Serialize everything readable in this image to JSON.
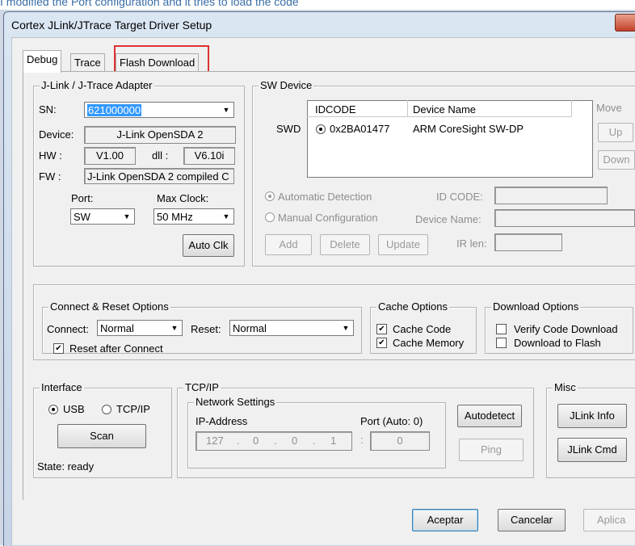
{
  "caption": "I modified the Port configuration and it tries  to load the code",
  "window": {
    "title": "Cortex JLink/JTrace Target Driver Setup"
  },
  "tabs": [
    {
      "label": "Debug"
    },
    {
      "label": "Trace"
    },
    {
      "label": "Flash Download"
    }
  ],
  "adapter": {
    "group_label": "J-Link / J-Trace Adapter",
    "sn_label": "SN:",
    "sn_value": "621000000",
    "device_label": "Device:",
    "device_value": "J-Link OpenSDA 2",
    "hw_label": "HW :",
    "hw_value": "V1.00",
    "dll_label": "dll :",
    "dll_value": "V6.10i",
    "fw_label": "FW :",
    "fw_value": "J-Link OpenSDA 2 compiled C",
    "port_label": "Port:",
    "port_value": "SW",
    "clock_label": "Max Clock:",
    "clock_value": "50 MHz",
    "autoclk_label": "Auto Clk"
  },
  "sw_device": {
    "group_label": "SW Device",
    "col_idcode": "IDCODE",
    "col_device": "Device Name",
    "row_label": "SWD",
    "row_idcode": "0x2BA01477",
    "row_device": "ARM CoreSight SW-DP",
    "move_label": "Move",
    "up_label": "Up",
    "down_label": "Down",
    "auto_detect": "Automatic Detection",
    "manual_config": "Manual Configuration",
    "idcode_label": "ID CODE:",
    "devname_label": "Device Name:",
    "irlen_label": "IR len:",
    "add_label": "Add",
    "delete_label": "Delete",
    "update_label": "Update"
  },
  "connect_reset": {
    "group_label": "Connect & Reset Options",
    "connect_label": "Connect:",
    "connect_value": "Normal",
    "reset_label": "Reset:",
    "reset_value": "Normal",
    "reset_after": "Reset after Connect"
  },
  "cache": {
    "group_label": "Cache Options",
    "code": "Cache Code",
    "memory": "Cache Memory"
  },
  "download": {
    "group_label": "Download Options",
    "verify": "Verify Code Download",
    "to_flash": "Download to Flash"
  },
  "interface": {
    "group_label": "Interface",
    "usb": "USB",
    "tcpip": "TCP/IP",
    "scan_label": "Scan",
    "state": "State: ready"
  },
  "tcpip": {
    "group_label": "TCP/IP",
    "network_label": "Network Settings",
    "ip_label": "IP-Address",
    "port_label": "Port (Auto: 0)",
    "ip1": "127",
    "ip2": "0",
    "ip3": "0",
    "ip4": "1",
    "port_value": "0",
    "autodetect_label": "Autodetect",
    "ping_label": "Ping"
  },
  "misc": {
    "group_label": "Misc",
    "info_label": "JLink Info",
    "cmd_label": "JLink Cmd"
  },
  "footer": {
    "ok_label": "Aceptar",
    "cancel_label": "Cancelar",
    "apply_label": "Aplica"
  },
  "colors": {
    "highlight": "#e03030",
    "selection": "#3399ff"
  }
}
